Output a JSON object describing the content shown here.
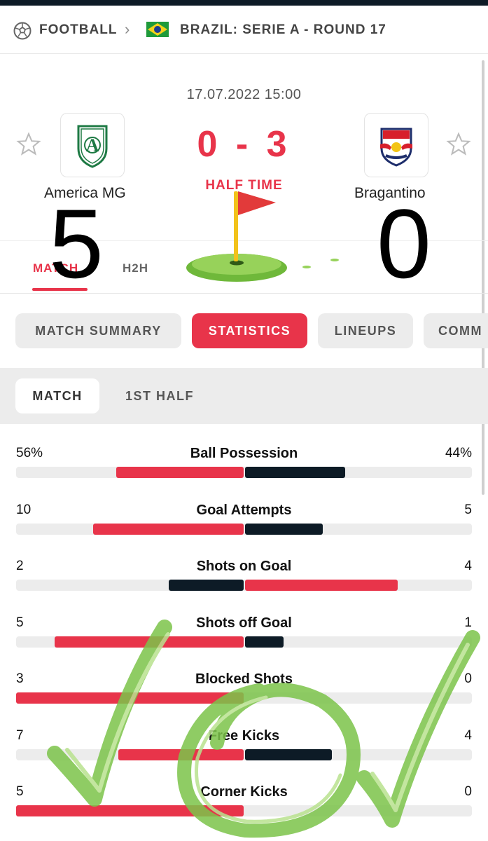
{
  "breadcrumb": {
    "sport": "FOOTBALL",
    "competition": "BRAZIL: SERIE A - ROUND 17"
  },
  "match": {
    "datetime": "17.07.2022 15:00",
    "home_team": "America MG",
    "away_team": "Bragantino",
    "score": "0 - 3",
    "status": "HALF TIME"
  },
  "overlay": {
    "home_number": "5",
    "away_number": "0"
  },
  "subtabs": {
    "match": "MATCH",
    "h2h": "H2H"
  },
  "tabs": [
    "MATCH SUMMARY",
    "STATISTICS",
    "LINEUPS",
    "COMM"
  ],
  "periods": [
    "MATCH",
    "1ST HALF"
  ],
  "stats": [
    {
      "label": "Ball Possession",
      "home": "56%",
      "away": "44%",
      "home_val": 56,
      "away_val": 44,
      "home_pct": 0.56,
      "away_pct": 0.44,
      "home_leads": true
    },
    {
      "label": "Goal Attempts",
      "home": "10",
      "away": "5",
      "home_val": 10,
      "away_val": 5,
      "home_pct": 0.66,
      "away_pct": 0.34,
      "home_leads": true
    },
    {
      "label": "Shots on Goal",
      "home": "2",
      "away": "4",
      "home_val": 2,
      "away_val": 4,
      "home_pct": 0.33,
      "away_pct": 0.67,
      "home_leads": false
    },
    {
      "label": "Shots off Goal",
      "home": "5",
      "away": "1",
      "home_val": 5,
      "away_val": 1,
      "home_pct": 0.83,
      "away_pct": 0.17,
      "home_leads": true
    },
    {
      "label": "Blocked Shots",
      "home": "3",
      "away": "0",
      "home_val": 3,
      "away_val": 0,
      "home_pct": 1.0,
      "away_pct": 0.0,
      "home_leads": true
    },
    {
      "label": "Free Kicks",
      "home": "7",
      "away": "4",
      "home_val": 7,
      "away_val": 4,
      "home_pct": 0.55,
      "away_pct": 0.38,
      "home_leads": true
    },
    {
      "label": "Corner Kicks",
      "home": "5",
      "away": "0",
      "home_val": 5,
      "away_val": 0,
      "home_pct": 1.0,
      "away_pct": 0.0,
      "home_leads": true
    }
  ],
  "colors": {
    "accent": "#e8344a",
    "dark": "#0d1b26",
    "scribble": "#7cc44a"
  },
  "icons": {
    "sport": "football-icon",
    "flag": "brazil-flag-icon",
    "favorite": "star-icon",
    "golf": "golf-flag-icon"
  }
}
